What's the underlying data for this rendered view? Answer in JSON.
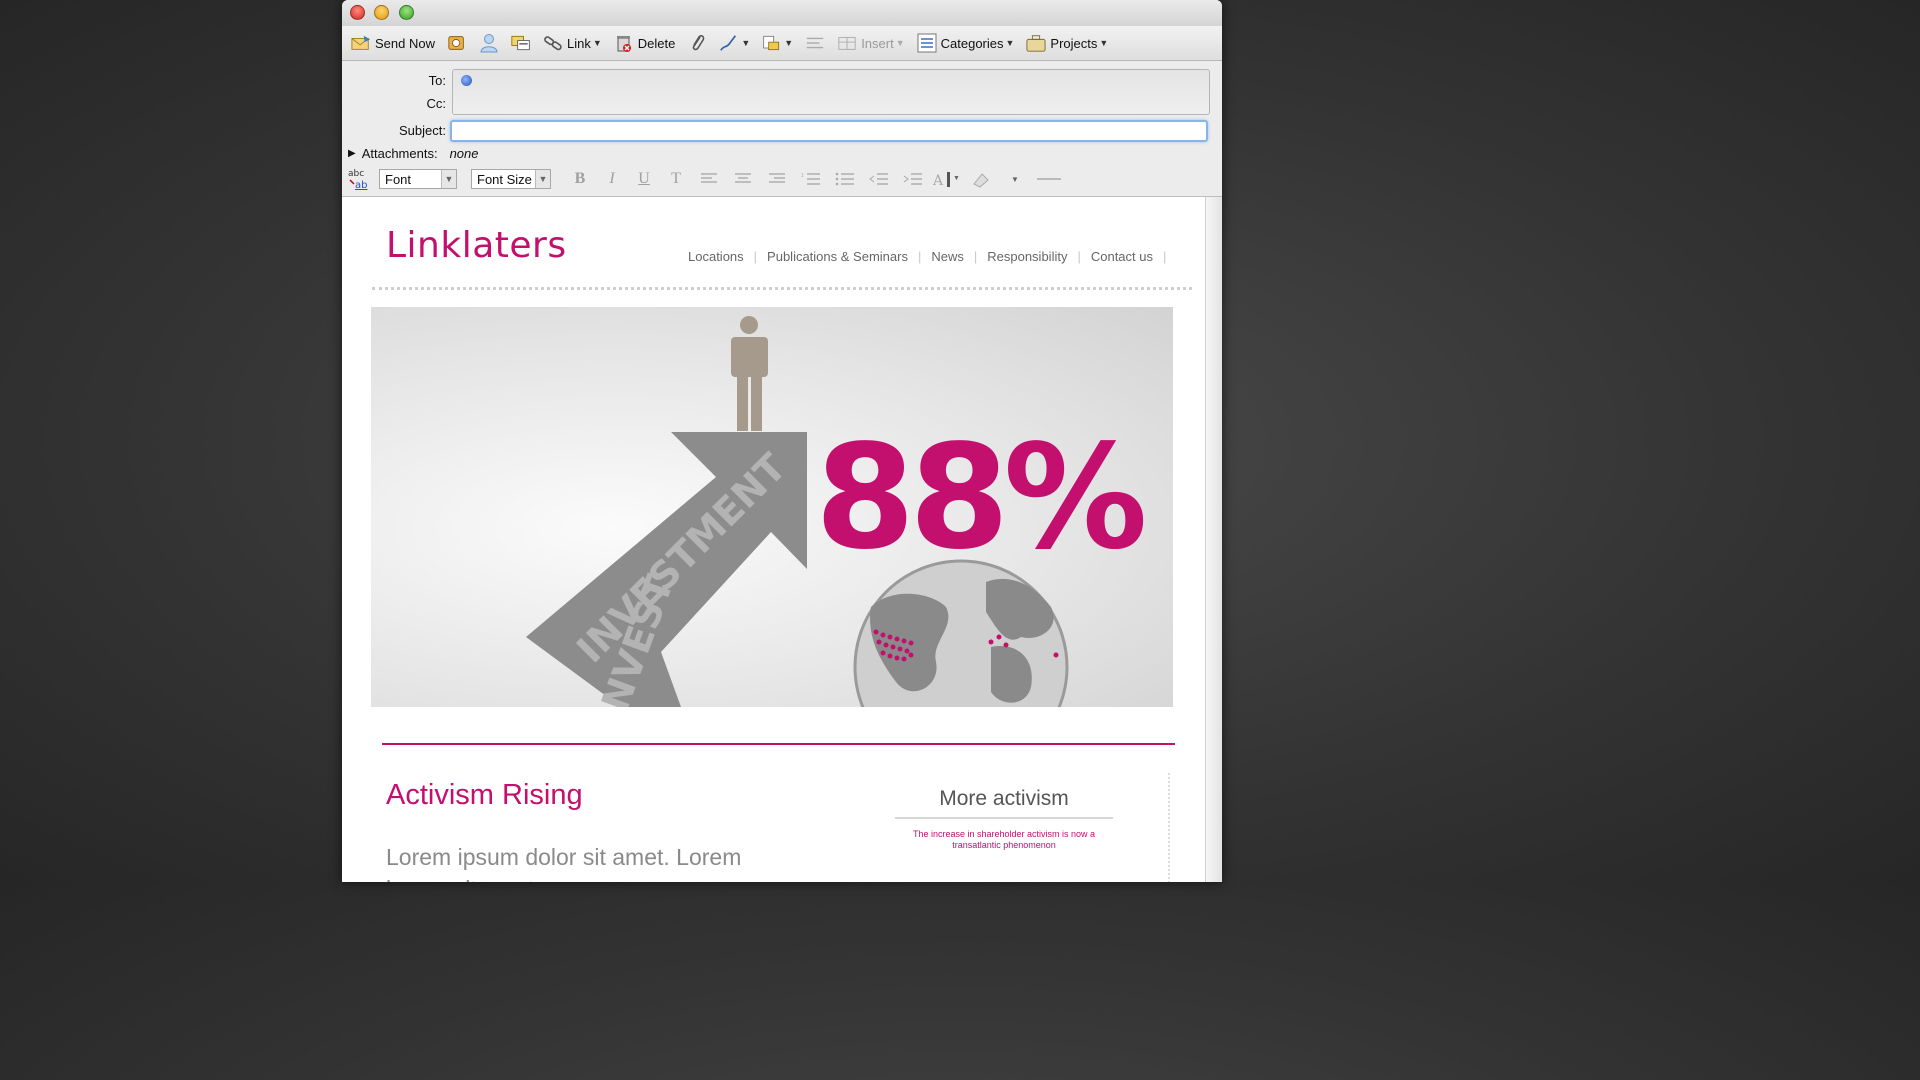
{
  "toolbar": {
    "send_now": "Send Now",
    "link": "Link",
    "delete": "Delete",
    "insert": "Insert",
    "categories": "Categories",
    "projects": "Projects"
  },
  "headers": {
    "to_label": "To:",
    "cc_label": "Cc:",
    "subject_label": "Subject:",
    "subject_value": "",
    "attachments_label": "Attachments:",
    "attachments_value": "none"
  },
  "format": {
    "font": "Font",
    "font_size": "Font Size",
    "bold": "B",
    "italic": "I",
    "underline": "U",
    "strike": "T"
  },
  "email": {
    "logo": "Linklaters",
    "nav": [
      "Locations",
      "Publications & Seminars",
      "News",
      "Responsibility",
      "Contact us"
    ],
    "hero_percent": "88%",
    "hero_arrow_text": "INVESTMENT",
    "hero_arrow_text_2": "INVEST",
    "article_title": "Activism Rising",
    "lorem": "Lorem ipsum dolor sit amet. Lorem ipsum sit amet",
    "more_title": "More activism",
    "more_sub": "The increase in shareholder activism is now a transatlantic phenomenon"
  },
  "colors": {
    "brand_magenta": "#c3106f",
    "arrow_gray": "#8c8c8c"
  }
}
